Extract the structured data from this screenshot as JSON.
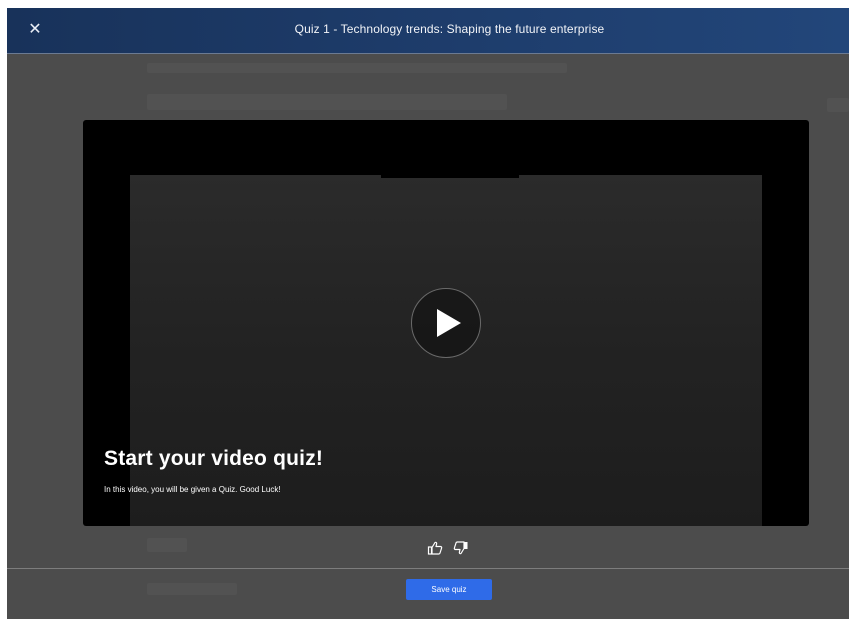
{
  "modal": {
    "close_icon": "close-icon",
    "title": "Quiz 1 - Technology trends: Shaping the future enterprise"
  },
  "video": {
    "play_icon": "play-icon",
    "overlay_title": "Start your video quiz!",
    "overlay_subtitle": "In this video, you will be given a Quiz. Good Luck!"
  },
  "rating": {
    "like_icon": "thumbs-up-icon",
    "dislike_icon": "thumbs-down-icon"
  },
  "footer": {
    "save_label": "Save quiz"
  },
  "colors": {
    "header": "#1d3b69",
    "overlay": "#4c4c4c",
    "save_button": "#2f6be8"
  }
}
